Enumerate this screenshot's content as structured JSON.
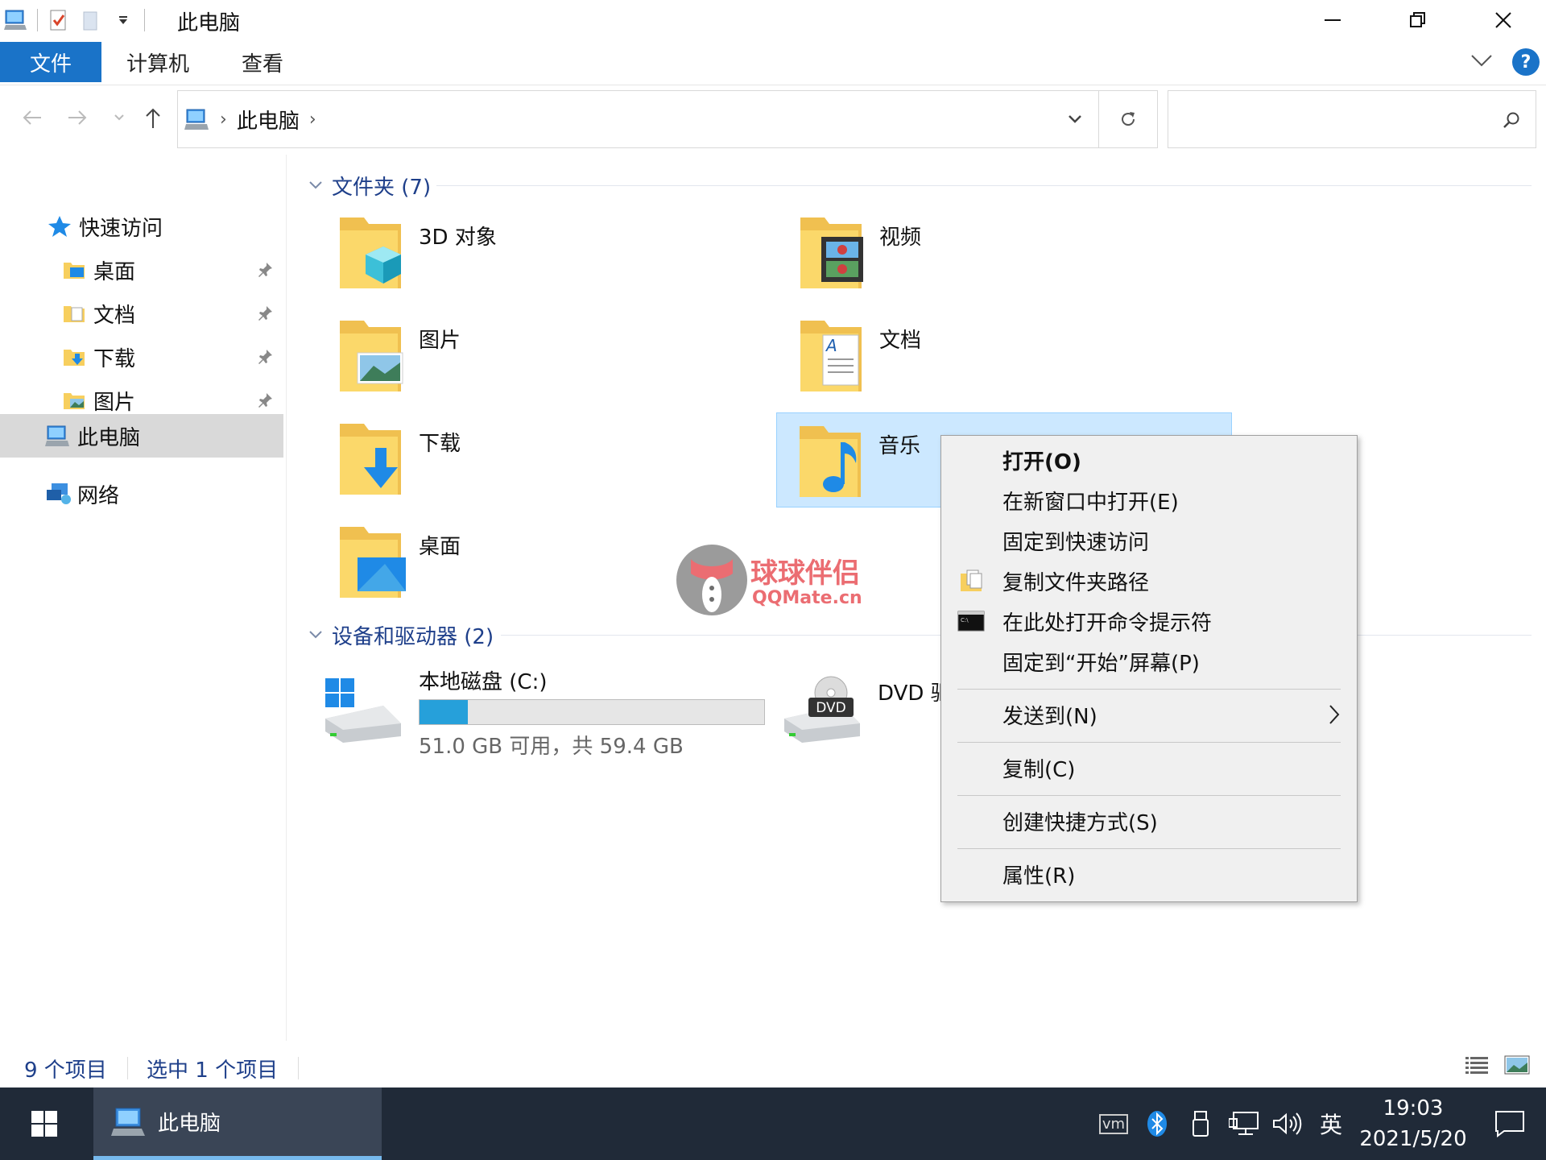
{
  "window": {
    "title": "此电脑"
  },
  "ribbon": {
    "tabs": [
      "文件",
      "计算机",
      "查看"
    ],
    "help_label": "?"
  },
  "address": {
    "path": [
      "此电脑"
    ]
  },
  "search": {
    "placeholder": ""
  },
  "sidebar": {
    "quick_access": "快速访问",
    "quick_items": [
      "桌面",
      "文档",
      "下载",
      "图片"
    ],
    "this_pc": "此电脑",
    "network": "网络"
  },
  "folders_group": {
    "header": "文件夹 (7)",
    "items": [
      "3D 对象",
      "视频",
      "图片",
      "文档",
      "下载",
      "音乐",
      "桌面"
    ],
    "selected": "音乐"
  },
  "drives_group": {
    "header": "设备和驱动器 (2)",
    "local_disk": {
      "name": "本地磁盘 (C:)",
      "free_text": "51.0 GB 可用，共 59.4 GB",
      "used_fraction": 0.14
    },
    "dvd": {
      "name": "DVD 驱",
      "badge": "DVD"
    }
  },
  "context_menu": {
    "items": [
      {
        "label": "打开(O)",
        "bold": true
      },
      {
        "label": "在新窗口中打开(E)"
      },
      {
        "label": "固定到快速访问"
      },
      {
        "label": "复制文件夹路径",
        "icon": "copy-path-icon"
      },
      {
        "label": "在此处打开命令提示符",
        "icon": "cmd-icon"
      },
      {
        "label": "固定到“开始”屏幕(P)"
      },
      {
        "label": "发送到(N)",
        "submenu": true
      },
      {
        "label": "复制(C)"
      },
      {
        "label": "创建快捷方式(S)"
      },
      {
        "label": "属性(R)"
      }
    ]
  },
  "status": {
    "count": "9 个项目",
    "selected": "选中 1 个项目"
  },
  "taskbar": {
    "app_label": "此电脑",
    "tray_ime": "英",
    "tray_vm": "vm",
    "time": "19:03",
    "date": "2021/5/20"
  },
  "watermark": {
    "brand": "球球伴侣",
    "domain": "QQMate.cn"
  },
  "colors": {
    "accent": "#1a73c8",
    "selection": "#cce8ff",
    "taskbar": "#202a38",
    "group_header": "#1e3f8a",
    "drive_fill": "#26a0da"
  }
}
